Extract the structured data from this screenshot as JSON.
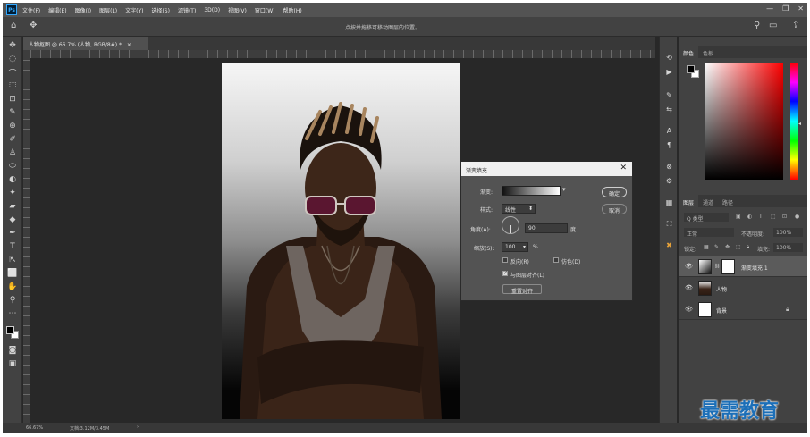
{
  "menu": [
    "文件(F)",
    "编辑(E)",
    "图像(I)",
    "图层(L)",
    "文字(Y)",
    "选择(S)",
    "滤镜(T)",
    "3D(D)",
    "视图(V)",
    "窗口(W)",
    "帮助(H)"
  ],
  "window_controls": [
    "—",
    "❐",
    "✕"
  ],
  "options_bar": {
    "hint": "点按并拖移可移动图层的位置。",
    "home_icon": "⌂",
    "move_icon": "✥"
  },
  "document": {
    "tab_title": "人物抠图 @ 66.7% (人物, RGB/8#) *",
    "close": "×"
  },
  "toolbar": [
    "✥",
    "◌",
    "⌒",
    "⬚",
    "⊡",
    "✎",
    "⊕",
    "✐",
    "♙",
    "⬭",
    "◐",
    "✦",
    "▰",
    "◆",
    "✒",
    "T",
    "⇱",
    "⬜",
    "✋",
    "⚲",
    "⋯"
  ],
  "dialog": {
    "title": "渐变填充",
    "close": "✕",
    "gradient_label": "渐变:",
    "style_label": "样式:",
    "style_value": "线性",
    "angle_label": "角度(A):",
    "angle_value": "90",
    "angle_unit": "度",
    "scale_label": "缩放(S):",
    "scale_value": "100",
    "scale_unit": "%",
    "reverse_label": "反向(R)",
    "dither_label": "仿色(D)",
    "align_label": "与图层对齐(L)",
    "reset_button": "重置对齐",
    "ok_button": "确定",
    "cancel_button": "取消"
  },
  "color_panel": {
    "tabs": [
      "颜色",
      "色板"
    ]
  },
  "layers_panel": {
    "tabs": [
      "图层",
      "通道",
      "路径"
    ],
    "filter_label": "Q 类型",
    "blend_mode": "正常",
    "opacity_label": "不透明度:",
    "opacity_value": "100%",
    "lock_label": "锁定:",
    "fill_label": "填充:",
    "fill_value": "100%",
    "layers": [
      {
        "name": "渐变填充 1",
        "selected": true
      },
      {
        "name": "人物",
        "selected": false
      },
      {
        "name": "背景",
        "selected": false
      }
    ]
  },
  "status_bar": {
    "zoom": "66.67%",
    "doc_info": "文档:3.12M/3.45M"
  },
  "watermark": "最需教育"
}
